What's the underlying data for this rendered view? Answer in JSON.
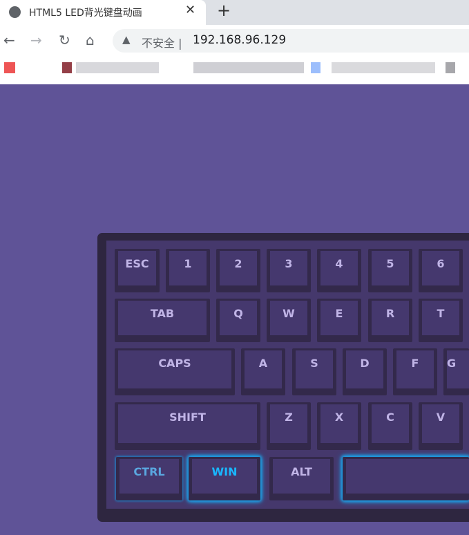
{
  "browser": {
    "tab_title": "HTML5 LED背光键盘动画",
    "close": "✕",
    "new_tab": "+",
    "back": "←",
    "forward": "→",
    "reload": "↻",
    "home": "⌂",
    "warning": "▲",
    "insecure_label": "不安全 |",
    "url": "192.168.96.129"
  },
  "keyboard": {
    "glow_color": "#1aa8f0",
    "rows": [
      [
        "ESC",
        "1",
        "2",
        "3",
        "4",
        "5",
        "6"
      ],
      [
        "TAB",
        "Q",
        "W",
        "E",
        "R",
        "T"
      ],
      [
        "CAPS",
        "A",
        "S",
        "D",
        "F",
        "G"
      ],
      [
        "SHIFT",
        "Z",
        "X",
        "C",
        "V"
      ],
      [
        "CTRL",
        "WIN",
        "ALT",
        ""
      ]
    ],
    "lit_keys": [
      "CTRL",
      "WIN",
      "SPACE"
    ]
  }
}
